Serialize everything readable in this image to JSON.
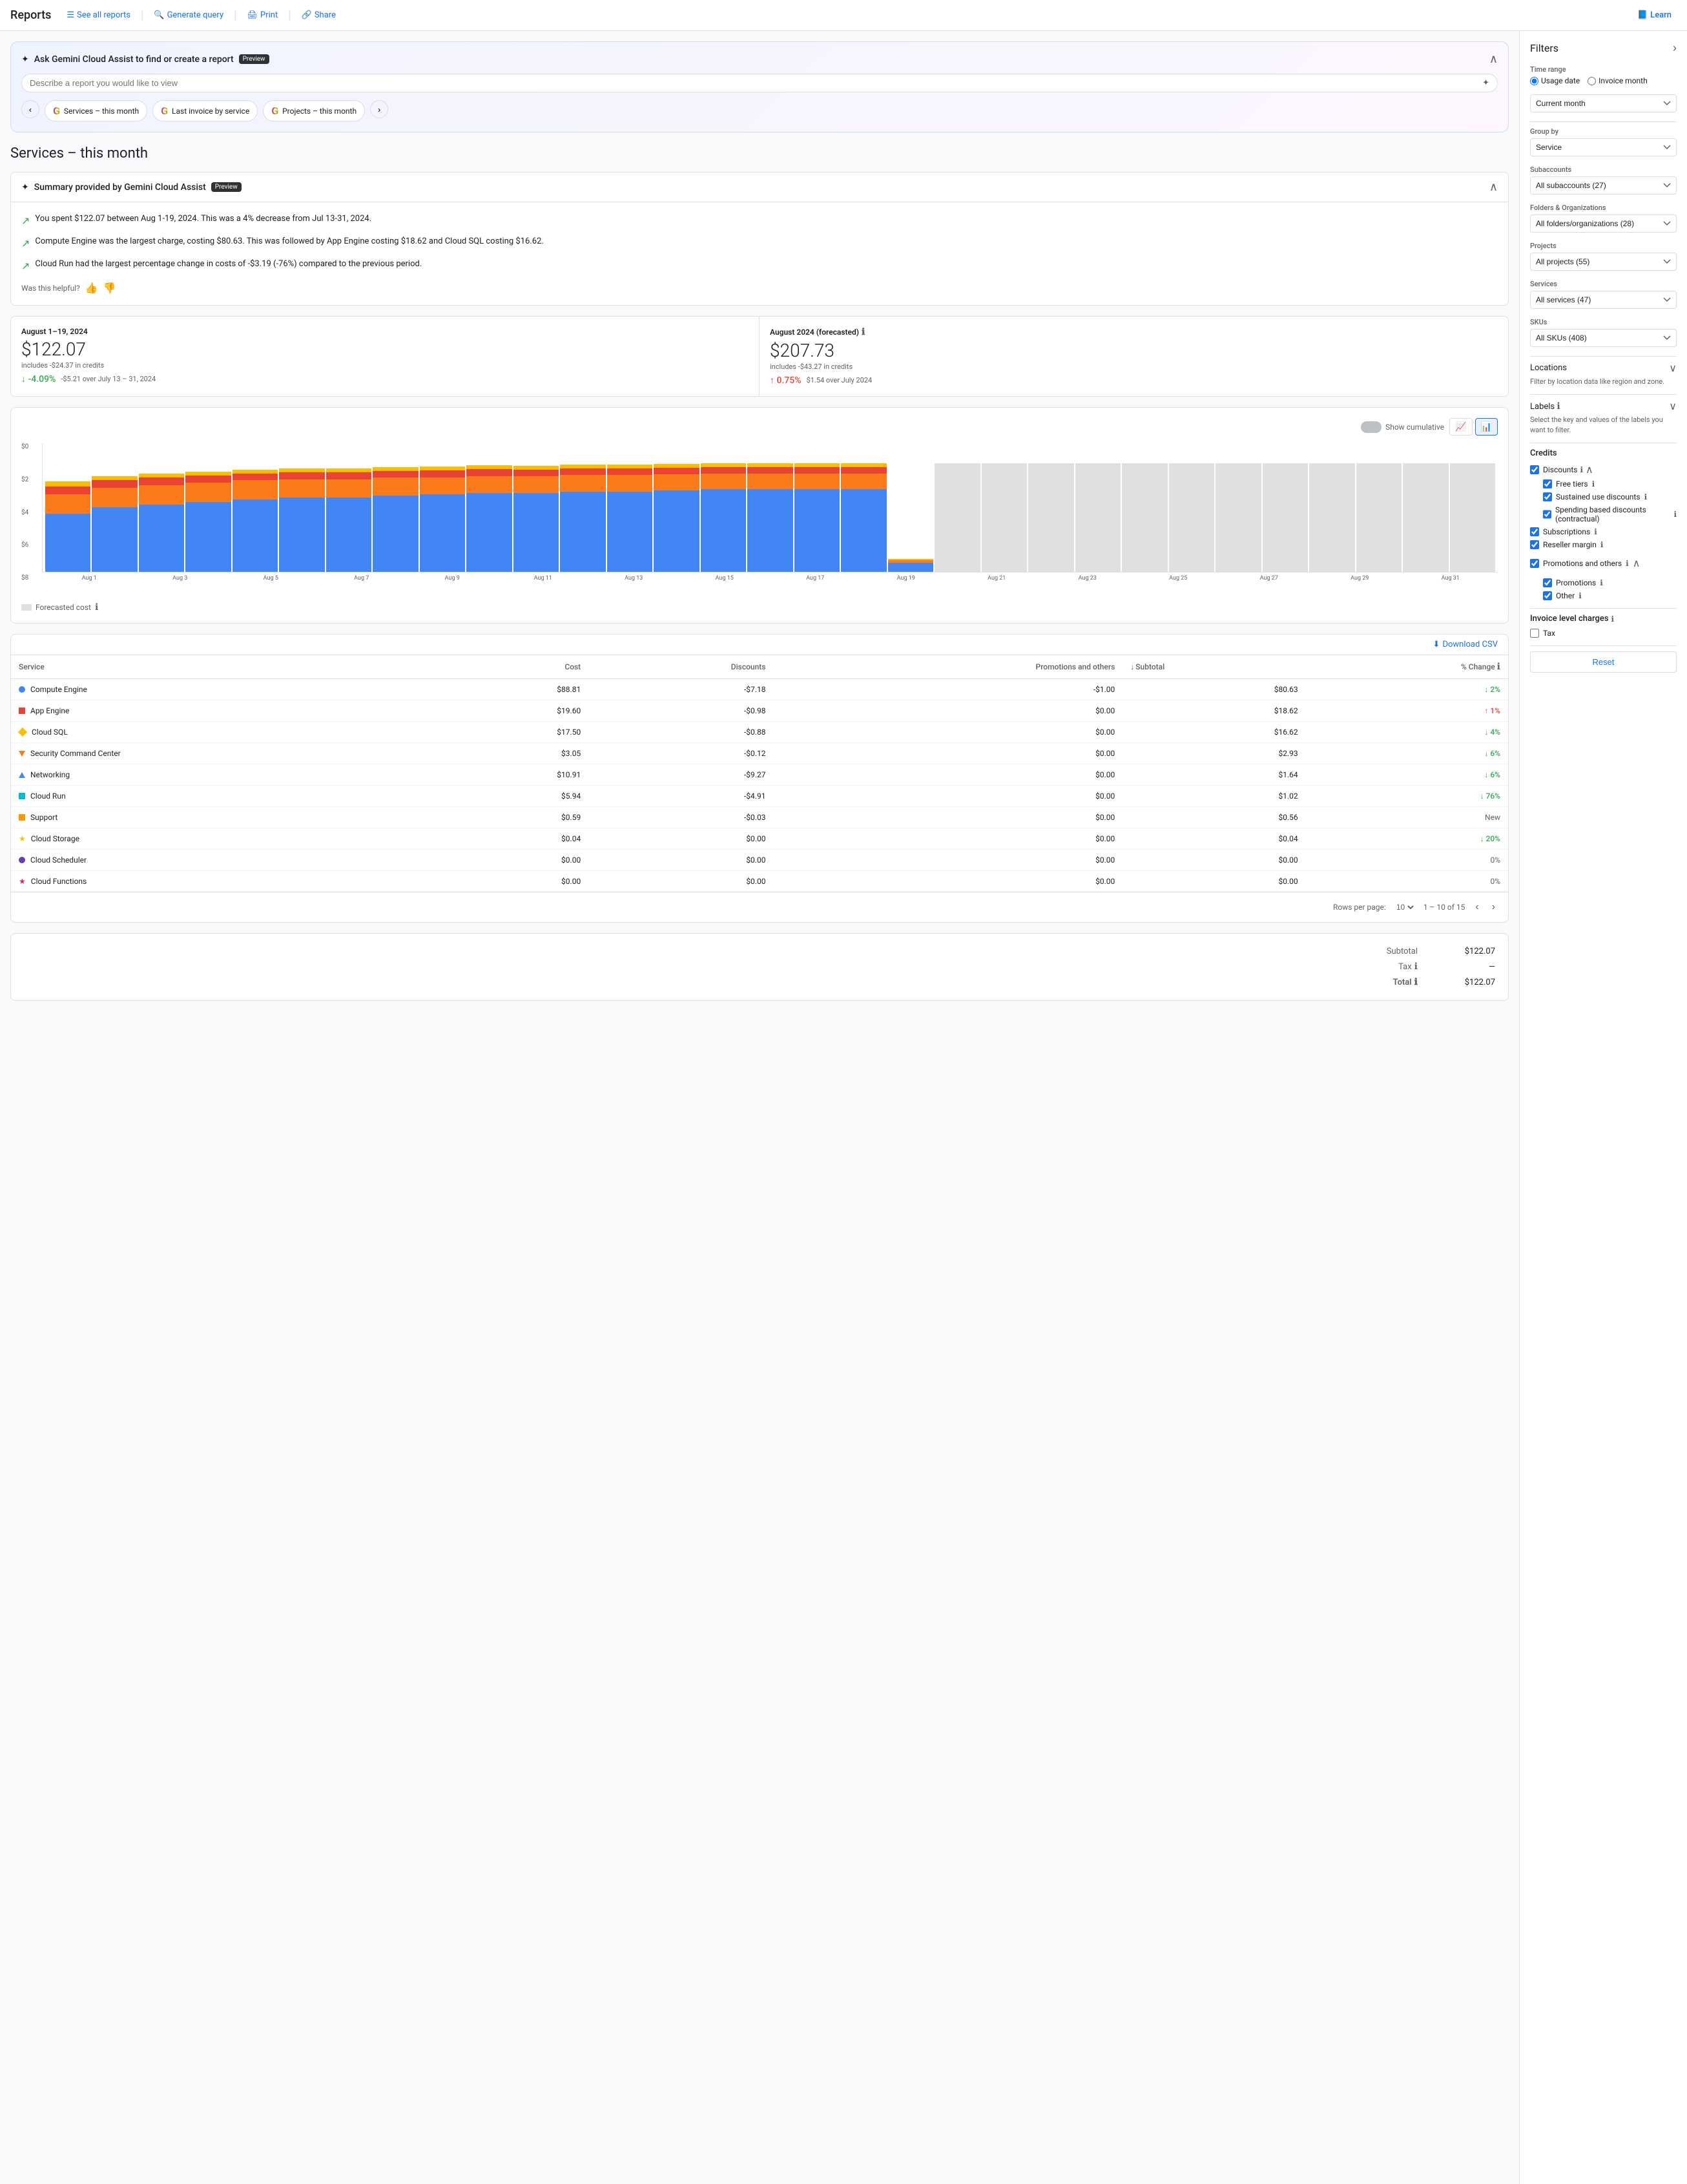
{
  "nav": {
    "title": "Reports",
    "links": [
      {
        "id": "see-all-reports",
        "label": "See all reports",
        "icon": "list-icon"
      },
      {
        "id": "generate-query",
        "label": "Generate query",
        "icon": "search-icon"
      },
      {
        "id": "print",
        "label": "Print",
        "icon": "print-icon"
      },
      {
        "id": "share",
        "label": "Share",
        "icon": "share-icon"
      }
    ],
    "learn": "Learn"
  },
  "gemini": {
    "title": "Ask Gemini Cloud Assist to find or create a report",
    "preview_badge": "Preview",
    "input_placeholder": "Describe a report you would like to view",
    "chips": [
      {
        "label": "Services – this month"
      },
      {
        "label": "Last invoice by service"
      },
      {
        "label": "Projects – this month"
      }
    ]
  },
  "page_title": "Services – this month",
  "summary": {
    "title": "Summary provided by Gemini Cloud Assist",
    "preview_badge": "Preview",
    "items": [
      "You spent $122.07 between Aug 1-19, 2024. This was a 4% decrease from Jul 13-31, 2024.",
      "Compute Engine was the largest charge, costing $80.63. This was followed by App Engine costing $18.62 and Cloud SQL costing $16.62.",
      "Cloud Run had the largest percentage change in costs of -$3.19 (-76%) compared to the previous period."
    ],
    "helpful_label": "Was this helpful?"
  },
  "metrics": {
    "current": {
      "period": "August 1–19, 2024",
      "amount": "$122.07",
      "sub": "includes -$24.37 in credits",
      "change_pct": "-4.09%",
      "change_desc": "-$5.21 over July 13 – 31, 2024",
      "change_dir": "down"
    },
    "forecasted": {
      "period": "August 2024 (forecasted)",
      "amount": "$207.73",
      "sub": "includes -$43.27 in credits",
      "change_pct": "0.75%",
      "change_desc": "$1.54 over July 2024",
      "change_dir": "up"
    }
  },
  "chart": {
    "show_cumulative": "Show cumulative",
    "y_labels": [
      "$8",
      "$6",
      "$4",
      "$2",
      "$0"
    ],
    "x_labels": [
      "Aug 1",
      "Aug 3",
      "Aug 5",
      "Aug 7",
      "Aug 9",
      "Aug 11",
      "Aug 13",
      "Aug 15",
      "Aug 17",
      "Aug 19",
      "Aug 21",
      "Aug 23",
      "Aug 25",
      "Aug 27",
      "Aug 29",
      "Aug 31"
    ],
    "forecasted_label": "Forecasted cost"
  },
  "table": {
    "download_csv": "Download CSV",
    "columns": [
      "Service",
      "Cost",
      "Discounts",
      "Promotions and others",
      "Subtotal",
      "% Change"
    ],
    "rows": [
      {
        "name": "Compute Engine",
        "cost": "$88.81",
        "discounts": "-$7.18",
        "promos": "-$1.00",
        "subtotal": "$80.63",
        "change": "2%",
        "change_dir": "down",
        "icon": "blue-dot"
      },
      {
        "name": "App Engine",
        "cost": "$19.60",
        "discounts": "-$0.98",
        "promos": "$0.00",
        "subtotal": "$18.62",
        "change": "1%",
        "change_dir": "up",
        "icon": "red-square"
      },
      {
        "name": "Cloud SQL",
        "cost": "$17.50",
        "discounts": "-$0.88",
        "promos": "$0.00",
        "subtotal": "$16.62",
        "change": "4%",
        "change_dir": "down",
        "icon": "yellow-diamond"
      },
      {
        "name": "Security Command Center",
        "cost": "$3.05",
        "discounts": "-$0.12",
        "promos": "$0.00",
        "subtotal": "$2.93",
        "change": "6%",
        "change_dir": "down",
        "icon": "orange-down-tri"
      },
      {
        "name": "Networking",
        "cost": "$10.91",
        "discounts": "-$9.27",
        "promos": "$0.00",
        "subtotal": "$1.64",
        "change": "6%",
        "change_dir": "down",
        "icon": "blue-up-tri"
      },
      {
        "name": "Cloud Run",
        "cost": "$5.94",
        "discounts": "-$4.91",
        "promos": "$0.00",
        "subtotal": "$1.02",
        "change": "76%",
        "change_dir": "down",
        "icon": "teal-square"
      },
      {
        "name": "Support",
        "cost": "$0.59",
        "discounts": "-$0.03",
        "promos": "$0.00",
        "subtotal": "$0.56",
        "change": "New",
        "change_dir": "neutral",
        "icon": "orange-circle"
      },
      {
        "name": "Cloud Storage",
        "cost": "$0.04",
        "discounts": "$0.00",
        "promos": "$0.00",
        "subtotal": "$0.04",
        "change": "20%",
        "change_dir": "down",
        "icon": "star-yellow"
      },
      {
        "name": "Cloud Scheduler",
        "cost": "$0.00",
        "discounts": "$0.00",
        "promos": "$0.00",
        "subtotal": "$0.00",
        "change": "0%",
        "change_dir": "neutral",
        "icon": "purple-dot"
      },
      {
        "name": "Cloud Functions",
        "cost": "$0.00",
        "discounts": "$0.00",
        "promos": "$0.00",
        "subtotal": "$0.00",
        "change": "0%",
        "change_dir": "neutral",
        "icon": "pink-star"
      }
    ],
    "pagination": {
      "rows_per_page": "Rows per page:",
      "rows_count": "10",
      "range": "1 – 10 of 15"
    }
  },
  "totals": {
    "subtotal_label": "Subtotal",
    "subtotal_value": "$122.07",
    "tax_label": "Tax",
    "tax_value": "—",
    "total_label": "Total",
    "total_value": "$122.07"
  },
  "filters": {
    "title": "Filters",
    "time_range": {
      "label": "Time range",
      "options": [
        "Usage date",
        "Invoice month"
      ],
      "selected": "Usage date"
    },
    "period": {
      "selected": "Current month"
    },
    "group_by": {
      "label": "Group by",
      "selected": "Service"
    },
    "subaccounts": {
      "label": "Subaccounts",
      "selected": "All subaccounts (27)"
    },
    "folders": {
      "label": "Folders & Organizations",
      "selected": "All folders/organizations (28)"
    },
    "projects": {
      "label": "Projects",
      "selected": "All projects (55)"
    },
    "services": {
      "label": "Services",
      "selected": "All services (47)"
    },
    "skus": {
      "label": "SKUs",
      "selected": "All SKUs (408)"
    },
    "locations": {
      "label": "Locations",
      "desc": "Filter by location data like region and zone."
    },
    "labels": {
      "label": "Labels",
      "desc": "Select the key and values of the labels you want to filter."
    },
    "credits": {
      "label": "Credits",
      "discounts": {
        "label": "Discounts",
        "items": [
          {
            "label": "Free tiers",
            "checked": true
          },
          {
            "label": "Sustained use discounts",
            "checked": true
          },
          {
            "label": "Spending based discounts (contractual)",
            "checked": true
          }
        ]
      },
      "other_items": [
        {
          "label": "Subscriptions",
          "checked": true
        },
        {
          "label": "Reseller margin",
          "checked": true
        }
      ],
      "promotions": {
        "label": "Promotions and others",
        "items": [
          {
            "label": "Promotions",
            "checked": true
          },
          {
            "label": "Other",
            "checked": true
          }
        ]
      }
    },
    "invoice_charges": {
      "label": "Invoice level charges",
      "tax": {
        "label": "Tax",
        "checked": false
      }
    },
    "reset_button": "Reset"
  }
}
